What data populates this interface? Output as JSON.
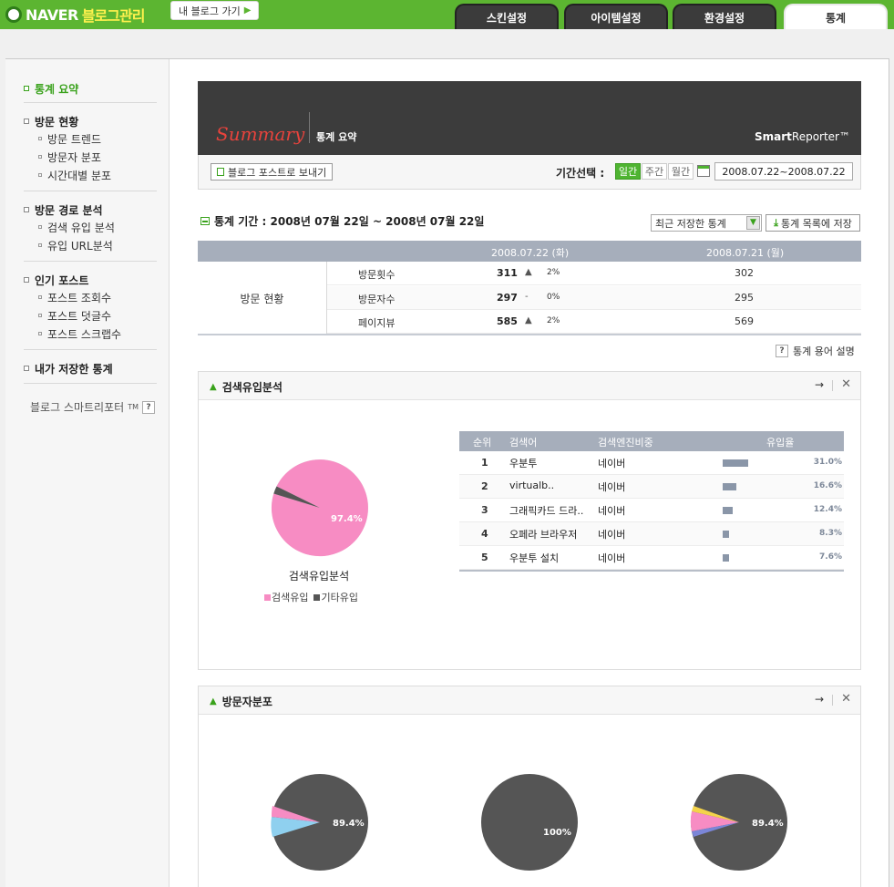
{
  "header": {
    "brand": "NAVER",
    "title": "블로그관리",
    "myblog_label": "내 블로그 가기",
    "tabs": [
      {
        "label": "스킨설정",
        "active": false
      },
      {
        "label": "아이템설정",
        "active": false
      },
      {
        "label": "환경설정",
        "active": false
      },
      {
        "label": "통계",
        "active": true
      }
    ]
  },
  "sidebar": {
    "summary": "통계 요약",
    "groups": [
      {
        "title": "방문 현황",
        "items": [
          "방문 트렌드",
          "방문자 분포",
          "시간대별 분포"
        ]
      },
      {
        "title": "방문 경로 분석",
        "items": [
          "검색 유입 분석",
          "유입 URL분석"
        ]
      },
      {
        "title": "인기 포스트",
        "items": [
          "포스트 조회수",
          "포스트 덧글수",
          "포스트 스크랩수"
        ]
      },
      {
        "title": "내가 저장한 통계",
        "items": []
      }
    ],
    "smart_reporter": "블로그 스마트리포터",
    "tm": "TM"
  },
  "summary": {
    "title": "Summary",
    "subtitle": "통계 요약",
    "brand_bold": "Smart",
    "brand_rest": "Reporter™",
    "post_button": "블로그 포스트로 보내기",
    "period_label": "기간선택 :",
    "period_tabs": [
      {
        "label": "일간",
        "active": true
      },
      {
        "label": "주간",
        "active": false
      },
      {
        "label": "월간",
        "active": false
      }
    ],
    "date_range": "2008.07.22~2008.07.22"
  },
  "stats": {
    "period_text": "통계 기간 : 2008년 07월 22일 ~ 2008년 07월 22일",
    "saved_select": "최근 저장한 통계",
    "save_button": "통계 목록에 저장",
    "col_current": "2008.07.22 (화)",
    "col_previous": "2008.07.21 (월)",
    "row_group": "방문 현황",
    "rows": [
      {
        "label": "방문횟수",
        "current": "311",
        "change": "▲",
        "pct": "2%",
        "previous": "302"
      },
      {
        "label": "방문자수",
        "current": "297",
        "change": "-",
        "pct": "0%",
        "previous": "295"
      },
      {
        "label": "페이지뷰",
        "current": "585",
        "change": "▲",
        "pct": "2%",
        "previous": "569"
      }
    ],
    "help_link": "통계 용어 설명",
    "help_icon": "?"
  },
  "search_panel": {
    "title": "검색유입분석",
    "go_icon": "→",
    "close_icon": "✕",
    "pie_percent": "97.4%",
    "pie_caption": "검색유입분석",
    "legend": [
      "검색유입",
      "기타유입"
    ],
    "colors": {
      "search": "#f78cc3",
      "other": "#555555"
    },
    "table_head": [
      "순위",
      "검색어",
      "검색엔진비중",
      "유입율"
    ],
    "rows": [
      {
        "rank": "1",
        "keyword": "우분투",
        "engine": "네이버",
        "share": 31.0,
        "pct": "31.0%"
      },
      {
        "rank": "2",
        "keyword": "virtualb..",
        "engine": "네이버",
        "share": 16.6,
        "pct": "16.6%"
      },
      {
        "rank": "3",
        "keyword": "그래픽카드 드라..",
        "engine": "네이버",
        "share": 12.4,
        "pct": "12.4%"
      },
      {
        "rank": "4",
        "keyword": "오페라 브라우저",
        "engine": "네이버",
        "share": 8.3,
        "pct": "8.3%"
      },
      {
        "rank": "5",
        "keyword": "우분투 설치",
        "engine": "네이버",
        "share": 7.6,
        "pct": "7.6%"
      }
    ]
  },
  "visitor_panel": {
    "title": "방문자분포",
    "go_icon": "→",
    "close_icon": "✕",
    "pies": [
      {
        "percent": "89.4%"
      },
      {
        "percent": "100%"
      },
      {
        "percent": "89.4%"
      }
    ]
  }
}
